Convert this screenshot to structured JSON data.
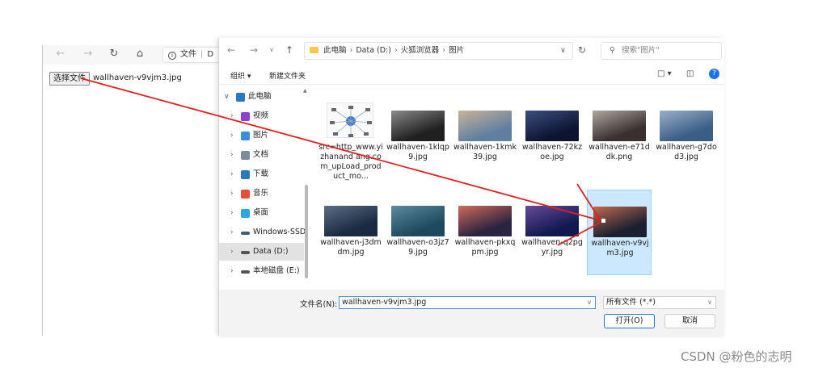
{
  "browser": {
    "url_label": "文件",
    "url_suffix": "D",
    "choose_file_label": "选择文件",
    "chosen_file": "wallhaven-v9vjm3.jpg"
  },
  "dialog": {
    "breadcrumbs": [
      "此电脑",
      "Data (D:)",
      "火狐浏览器",
      "图片"
    ],
    "search_placeholder": "搜索\"图片\"",
    "toolbar": {
      "organize": "组织 ▾",
      "new_folder": "新建文件夹"
    },
    "sidebar": [
      {
        "label": "此电脑",
        "icon": "computer-icon",
        "color": "#2b78c2"
      },
      {
        "label": "视频",
        "icon": "video-icon",
        "color": "#8b3fd6"
      },
      {
        "label": "图片",
        "icon": "pictures-icon",
        "color": "#3a8fd6"
      },
      {
        "label": "文档",
        "icon": "documents-icon",
        "color": "#7a8ca0"
      },
      {
        "label": "下载",
        "icon": "download-icon",
        "color": "#2b78c2"
      },
      {
        "label": "音乐",
        "icon": "music-icon",
        "color": "#e0503c"
      },
      {
        "label": "桌面",
        "icon": "desktop-icon",
        "color": "#2aa6e0"
      },
      {
        "label": "Windows-SSD",
        "icon": "drive-icon",
        "color": "#3a5a8a"
      },
      {
        "label": "Data (D:)",
        "icon": "drive-icon",
        "color": "#555555"
      },
      {
        "label": "本地磁盘 (E:)",
        "icon": "drive-icon",
        "color": "#555555"
      }
    ],
    "files": [
      {
        "name": "src=http_www.yizhanand ang.com_upLoad_product_mo...",
        "kind": "network"
      },
      {
        "name": "wallhaven-1klqp9.jpg",
        "colors": [
          "#202020",
          "#8a8a8a"
        ]
      },
      {
        "name": "wallhaven-1kmk39.jpg",
        "colors": [
          "#5f7fa0",
          "#c9b39a"
        ]
      },
      {
        "name": "wallhaven-72kzoe.jpg",
        "colors": [
          "#0c1530",
          "#3e4e84"
        ]
      },
      {
        "name": "wallhaven-e71ddk.png",
        "colors": [
          "#3a3030",
          "#b0a6a0"
        ]
      },
      {
        "name": "wallhaven-g7dod3.jpg",
        "colors": [
          "#3a5e86",
          "#9cb0c8"
        ]
      },
      {
        "name": "wallhaven-j3dmdm.jpg",
        "colors": [
          "#1a2a40",
          "#5a6e86"
        ]
      },
      {
        "name": "wallhaven-o3jz79.jpg",
        "colors": [
          "#1e4a60",
          "#5e8aa0"
        ]
      },
      {
        "name": "wallhaven-pkxqpm.jpg",
        "colors": [
          "#2a2440",
          "#d06a5a"
        ]
      },
      {
        "name": "wallhaven-q2pgyr.jpg",
        "colors": [
          "#101a50",
          "#6a4a9a"
        ]
      },
      {
        "name": "wallhaven-v9vjm3.jpg",
        "colors": [
          "#1a2030",
          "#c06a50"
        ],
        "selected": true
      }
    ],
    "filename_label": "文件名(N):",
    "filename_value": "wallhaven-v9vjm3.jpg",
    "filetype": "所有文件 (*.*)",
    "open_label": "打开(O)",
    "cancel_label": "取消"
  },
  "watermark": "CSDN @粉色的志明",
  "accent_color": "#1a73e8",
  "annotation_color": "#e02020"
}
